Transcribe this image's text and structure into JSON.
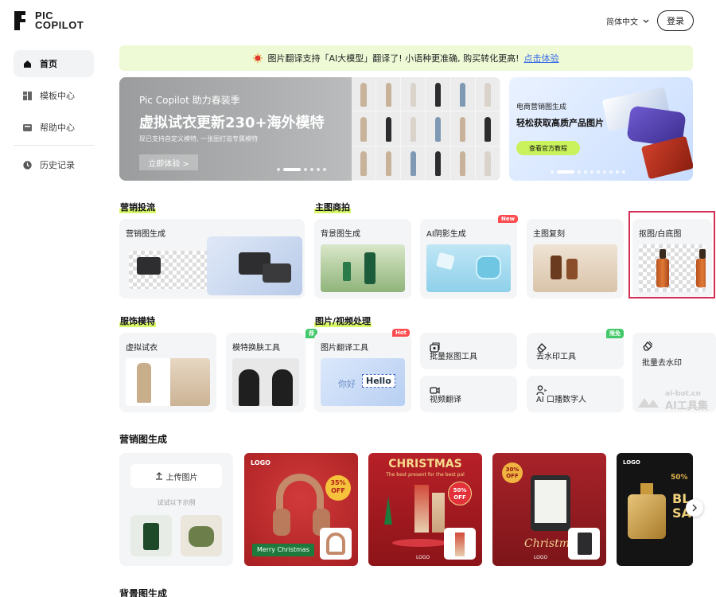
{
  "brand": {
    "line1": "PIC",
    "line2": "COPILOT"
  },
  "header": {
    "language": "简体中文",
    "login_label": "登录"
  },
  "sidebar": {
    "items": [
      {
        "label": "首页",
        "icon": "home-icon",
        "active": true
      },
      {
        "label": "模板中心",
        "icon": "template-icon",
        "active": false
      },
      {
        "label": "帮助中心",
        "icon": "help-icon",
        "active": false
      },
      {
        "label": "历史记录",
        "icon": "history-icon",
        "active": false
      }
    ]
  },
  "notice": {
    "text": "图片翻译支持「AI大模型」翻译了! 小语种更准确, 购买转化更高!",
    "link": "点击体验"
  },
  "banners": {
    "main": {
      "subtitle": "Pic Copilot 助力春装季",
      "title": "虚拟试衣更新230+海外模特",
      "desc": "现已支持自定义模特, 一张图打造专属模特",
      "button": "立即体验 >"
    },
    "side": {
      "subtitle": "电商营销图生成",
      "title": "轻松获取高质产品图片",
      "button": "查看官方教程"
    }
  },
  "sections": {
    "marketing": "营销投流",
    "main_image": "主图商拍",
    "apparel": "服饰模特",
    "image_video": "图片/视频处理",
    "marketing_gen": "营销图生成",
    "background_gen": "背景图生成"
  },
  "tools_row1": [
    {
      "label": "营销图生成"
    },
    {
      "label": "背景图生成"
    },
    {
      "label": "AI阴影生成",
      "badge": "New"
    },
    {
      "label": "主图复刻"
    },
    {
      "label": "抠图/白底图"
    }
  ],
  "tools_row2": [
    {
      "label": "虚拟试衣"
    },
    {
      "label": "模特换肤工具",
      "badge": "荐"
    },
    {
      "label": "图片翻译工具",
      "badge": "Hot",
      "sample_prefix": "你好",
      "sample_text": "Hello"
    }
  ],
  "mini_tools": [
    {
      "label": "批量抠图工具",
      "icon": "batch-cutout-icon"
    },
    {
      "label": "去水印工具",
      "icon": "eraser-icon",
      "badge": "限免"
    },
    {
      "label": "批量去水印",
      "icon": "batch-eraser-icon"
    },
    {
      "label": "视频翻译",
      "icon": "video-icon"
    },
    {
      "label": "AI 口播数字人",
      "icon": "avatar-icon"
    }
  ],
  "upload": {
    "button": "上传图片",
    "try_text": "试试以下示例"
  },
  "gallery": [
    {
      "logo": "LOGO",
      "badge_pct": "35%",
      "badge_off": "OFF",
      "caption": "Merry Christmas"
    },
    {
      "headline": "CHRISTMAS",
      "sub": "The best present for the best pal",
      "badge_pct": "50%",
      "badge_off": "OFF",
      "logo": "LOGO"
    },
    {
      "badge_pct": "30%",
      "badge_off": "OFF",
      "script": "Christmas",
      "logo": "LOGO"
    },
    {
      "logo": "LOGO",
      "badge_pct": "50%",
      "sale": "BL",
      "sale2": "SA"
    }
  ],
  "watermark": {
    "line1": "ai-bot.cn",
    "line2": "AI工具集"
  }
}
